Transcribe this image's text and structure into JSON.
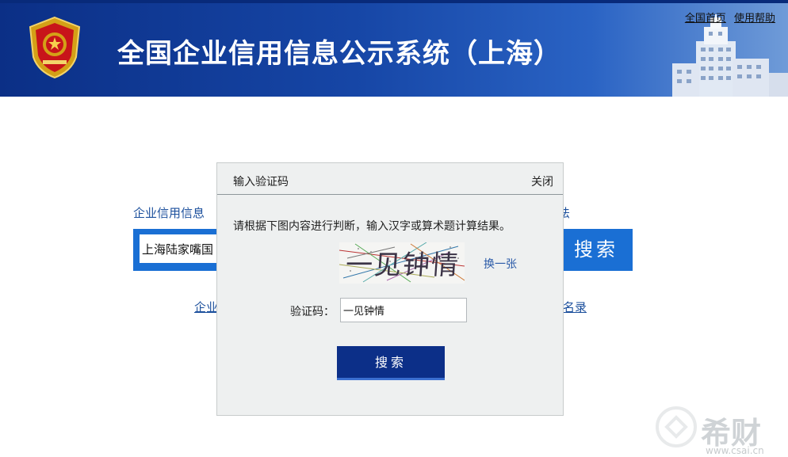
{
  "header": {
    "site_title": "全国企业信用信息公示系统（上海）",
    "links": [
      "全国首页",
      "使用帮助"
    ]
  },
  "background_search": {
    "tab_left": "企业信用信息",
    "tab_right": "法",
    "input_value": "上海陆家嘴国",
    "search_button": "搜索",
    "link_left": "企业",
    "link_right": "名录"
  },
  "captcha_dialog": {
    "title": "输入验证码",
    "close_label": "关闭",
    "instruction": "请根据下图内容进行判断，输入汉字或算术题计算结果。",
    "captcha_text": "一见钟情",
    "refresh_label": "换一张",
    "code_label": "验证码：",
    "code_value": "一见钟情",
    "submit_label": "搜索"
  },
  "watermark": {
    "brand": "希财",
    "url": "www.csai.cn"
  },
  "colors": {
    "header_dark": "#0b2f86",
    "search_bar": "#1a6fd4",
    "submit_button": "#0c2f88",
    "link": "#1b4f9c"
  }
}
